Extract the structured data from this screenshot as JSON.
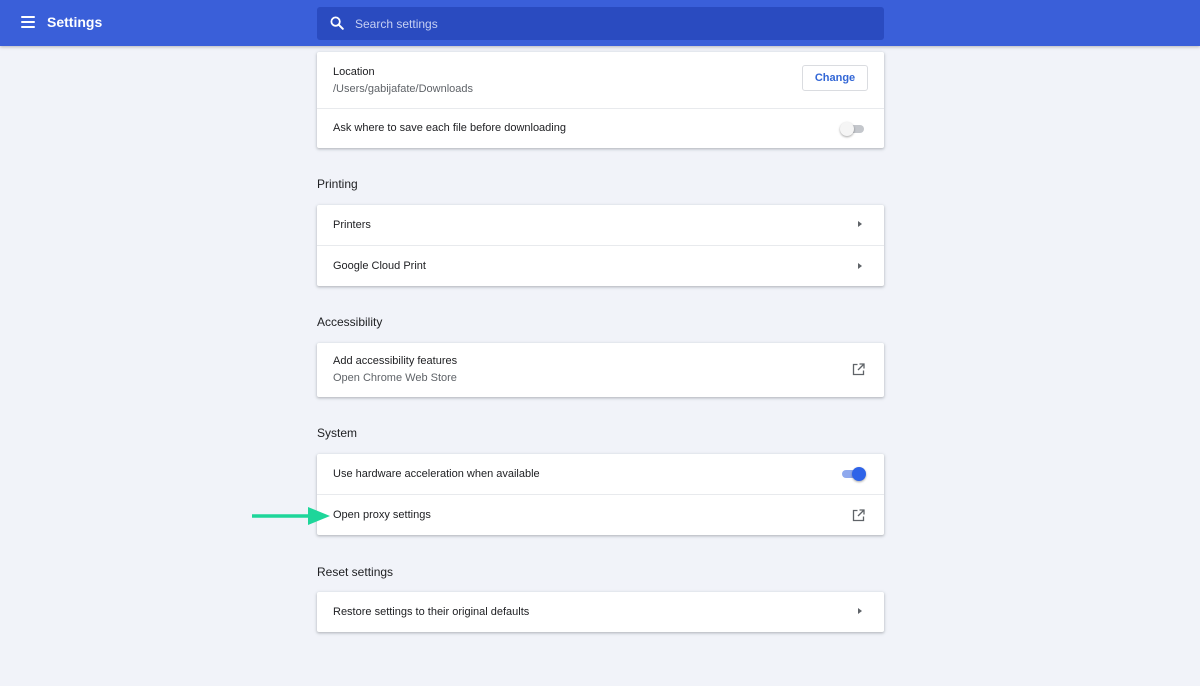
{
  "header": {
    "title": "Settings",
    "search_placeholder": "Search settings",
    "icons": [
      "menu-icon",
      "search-icon"
    ]
  },
  "downloads": {
    "location_label": "Location",
    "location_value": "/Users/gabijafate/Downloads",
    "change_label": "Change",
    "ask_label": "Ask where to save each file before downloading",
    "ask_enabled": false
  },
  "printing": {
    "title": "Printing",
    "items": [
      {
        "label": "Printers"
      },
      {
        "label": "Google Cloud Print"
      }
    ]
  },
  "accessibility": {
    "title": "Accessibility",
    "add_label": "Add accessibility features",
    "add_sub": "Open Chrome Web Store"
  },
  "system": {
    "title": "System",
    "hardware_label": "Use hardware acceleration when available",
    "hardware_enabled": true,
    "proxy_label": "Open proxy settings"
  },
  "reset": {
    "title": "Reset settings",
    "restore_label": "Restore settings to their original defaults"
  },
  "colors": {
    "header_bg": "#3a5fd9",
    "accent": "#3367d6",
    "toggle_on": "#2e63e8",
    "annotation_arrow": "#1ed69a"
  }
}
